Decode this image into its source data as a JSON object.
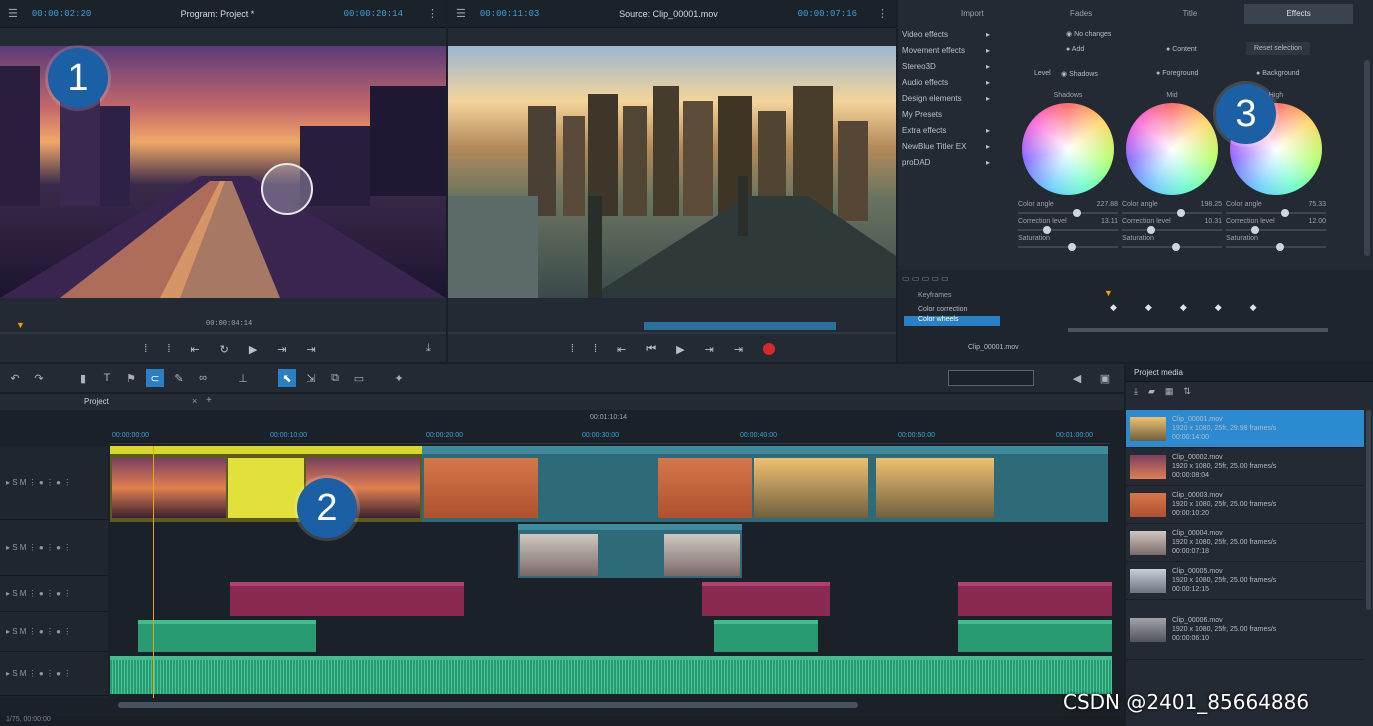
{
  "program_monitor": {
    "menu_icon": "menu-icon",
    "timecode_left": "00:00:02:20",
    "title": "Program: Project *",
    "timecode_right": "00:00:20:14",
    "position": "00:00:04:14"
  },
  "source_monitor": {
    "timecode_left": "00:00:11:03",
    "title": "Source: Clip_00001.mov",
    "timecode_right": "00:00:07:16"
  },
  "badges": {
    "one": "1",
    "two": "2",
    "three": "3"
  },
  "effects_panel": {
    "tabs": [
      "Import",
      "Fades",
      "Title",
      "Effects"
    ],
    "active_tab": "Effects",
    "categories": [
      "Video effects",
      "Movement effects",
      "Stereo3D",
      "Audio effects",
      "Design elements",
      "My Presets",
      "Extra effects",
      "NewBlue Titler EX",
      "proDAD"
    ],
    "options": {
      "no_changes": "No changes",
      "add": "Add",
      "content": "Content",
      "reset_selection": "Reset selection",
      "level": "Level",
      "shadows": "Shadows",
      "foreground": "Foreground",
      "background": "Background"
    },
    "wheel_titles": [
      "Shadows",
      "Mid",
      "High"
    ],
    "wheel_params": {
      "color_angle": "Color angle",
      "correction_level": "Correction level",
      "saturation": "Saturation",
      "values": [
        {
          "angle": "227.88",
          "level": "13.11"
        },
        {
          "angle": "198.25",
          "level": "10.31"
        },
        {
          "angle": "75.33",
          "level": "12.00"
        }
      ]
    },
    "keyframes": {
      "selected_label": "Keyframes",
      "item1": "Color correction",
      "item2": "Color wheels",
      "clip_name": "Clip_00001.mov"
    }
  },
  "timeline": {
    "tab_label": "Project",
    "center_time": "00:01:10:14",
    "ruler": [
      "00:00:00:00",
      "00:00:10:00",
      "00:00:20:00",
      "00:00:30:00",
      "00:00:40:00",
      "00:00:50:00",
      "00:01:00:00"
    ],
    "status": "1/75, 00:00:00"
  },
  "media_pool": {
    "title": "Project media",
    "items": [
      {
        "name": "Clip_00001.mov",
        "meta": "1920 x 1080, 25fr, 29.98 frames/s",
        "dur": "00:00:14:00"
      },
      {
        "name": "Clip_00002.mov",
        "meta": "1920 x 1080, 25fr, 25.00 frames/s",
        "dur": "00:00:08:04"
      },
      {
        "name": "Clip_00003.mov",
        "meta": "1920 x 1080, 25fr, 25.00 frames/s",
        "dur": "00:00:10:20"
      },
      {
        "name": "Clip_00004.mov",
        "meta": "1920 x 1080, 25fr, 25.00 frames/s",
        "dur": "00:00:07:18"
      },
      {
        "name": "Clip_00005.mov",
        "meta": "1920 x 1080, 25fr, 25.00 frames/s",
        "dur": "00:00:12:15"
      },
      {
        "name": "Clip_00006.mov",
        "meta": "1920 x 1080, 25fr, 25.00 frames/s",
        "dur": "00:00:06:10"
      }
    ]
  },
  "watermark": "CSDN @2401_85664886"
}
